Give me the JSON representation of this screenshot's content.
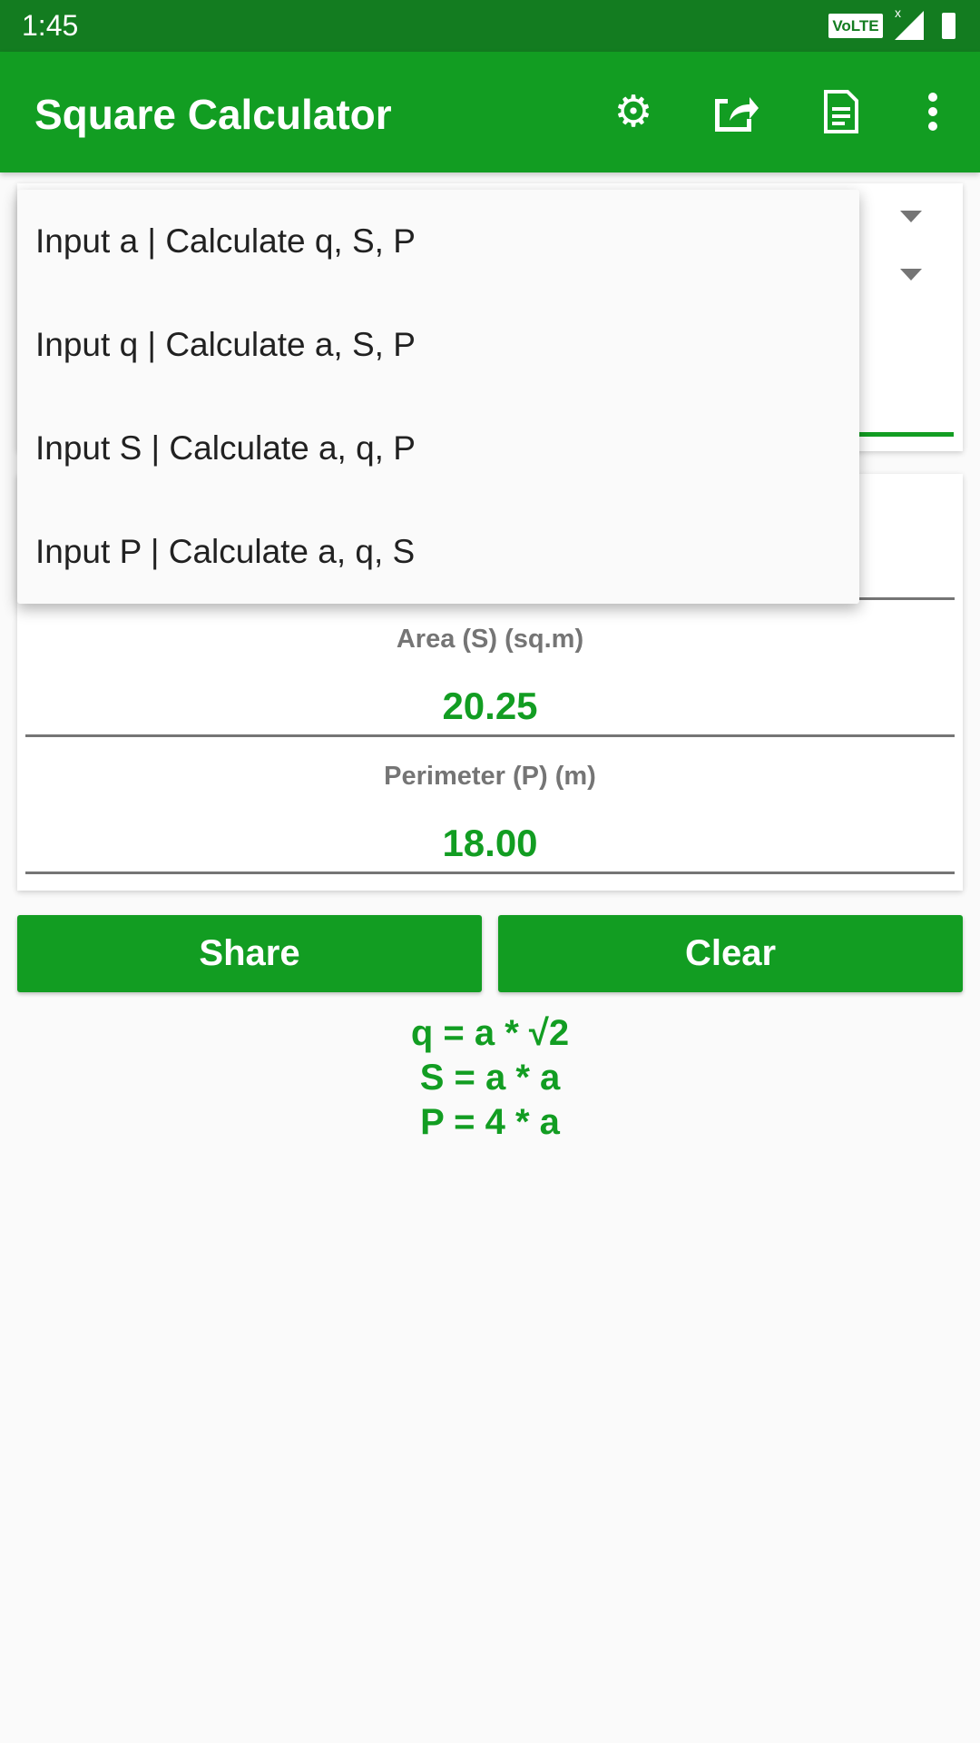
{
  "status_bar": {
    "time": "1:45",
    "network": "VoLTE",
    "signal_x": "x"
  },
  "app_bar": {
    "title": "Square Calculator",
    "icons": [
      "gear-icon",
      "share-icon",
      "document-icon",
      "more-vert-icon"
    ]
  },
  "dropdown": {
    "options": [
      "Input a | Calculate q, S, P",
      "Input q | Calculate a, S, P",
      "Input S | Calculate a, q, P",
      "Input P | Calculate a, q, S"
    ]
  },
  "results": {
    "area_label": "Area (S) (sq.m)",
    "area_value": "20.25",
    "perimeter_label": "Perimeter (P) (m)",
    "perimeter_value": "18.00"
  },
  "buttons": {
    "share": "Share",
    "clear": "Clear"
  },
  "formulas": [
    "q = a * √2",
    "S = a * a",
    "P = 4 * a"
  ],
  "colors": {
    "primary": "#129d22",
    "status_bar": "#137c20"
  }
}
